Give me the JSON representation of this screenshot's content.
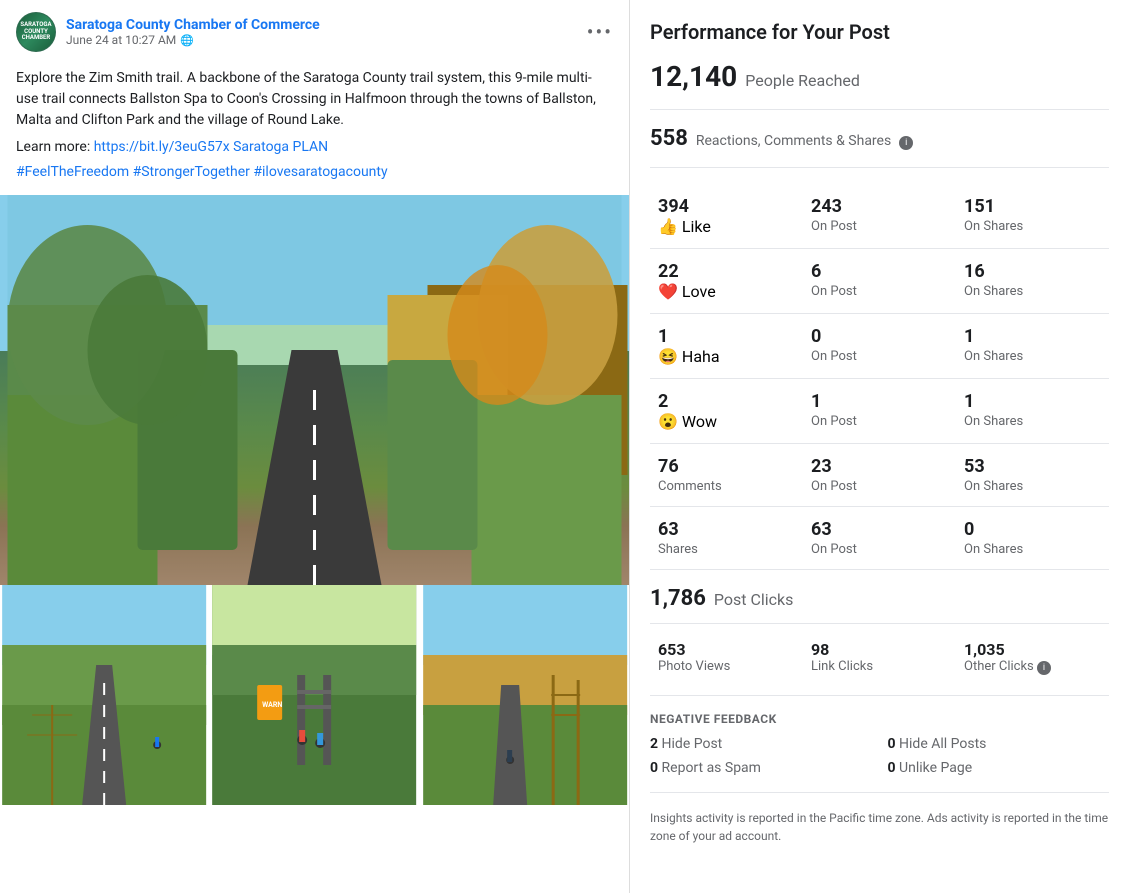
{
  "post": {
    "author": "Saratoga County Chamber of Commerce",
    "date": "June 24 at 10:27 AM",
    "more_icon": "•••",
    "text_parts": [
      "Explore the Zim Smith trail. A backbone of the Saratoga County trail system, this 9-mile multi-use trail connects Ballston Spa to Coon's Crossing in Halfmoon through the towns of Ballston, Malta and Clifton Park and the village of Round Lake.",
      "Learn more: https://bit.ly/3euG57x Saratoga PLAN",
      "#FeelTheFreedom #StrongerTogether #ilovesaratogacounty"
    ],
    "link_text": "https://bit.ly/3euG57x Saratoga PLAN"
  },
  "performance": {
    "title": "Performance for Your Post",
    "people_reached": {
      "number": "12,140",
      "label": "People Reached"
    },
    "reactions_summary": {
      "number": "558",
      "label": "Reactions, Comments & Shares"
    },
    "stats_rows": [
      {
        "type_num": "394",
        "type_emoji": "👍",
        "type_name": "Like",
        "on_post_num": "243",
        "on_post_label": "On Post",
        "on_shares_num": "151",
        "on_shares_label": "On Shares"
      },
      {
        "type_num": "22",
        "type_emoji": "❤️",
        "type_name": "Love",
        "on_post_num": "6",
        "on_post_label": "On Post",
        "on_shares_num": "16",
        "on_shares_label": "On Shares"
      },
      {
        "type_num": "1",
        "type_emoji": "😆",
        "type_name": "Haha",
        "on_post_num": "0",
        "on_post_label": "On Post",
        "on_shares_num": "1",
        "on_shares_label": "On Shares"
      },
      {
        "type_num": "2",
        "type_emoji": "😮",
        "type_name": "Wow",
        "on_post_num": "1",
        "on_post_label": "On Post",
        "on_shares_num": "1",
        "on_shares_label": "On Shares"
      },
      {
        "type_num": "76",
        "type_emoji": "",
        "type_name": "Comments",
        "on_post_num": "23",
        "on_post_label": "On Post",
        "on_shares_num": "53",
        "on_shares_label": "On Shares"
      },
      {
        "type_num": "63",
        "type_emoji": "",
        "type_name": "Shares",
        "on_post_num": "63",
        "on_post_label": "On Post",
        "on_shares_num": "0",
        "on_shares_label": "On Shares"
      }
    ],
    "post_clicks": {
      "number": "1,786",
      "label": "Post Clicks"
    },
    "clicks_breakdown": [
      {
        "num": "653",
        "label": "Photo Views"
      },
      {
        "num": "98",
        "label": "Link Clicks"
      },
      {
        "num": "1,035",
        "label": "Other Clicks"
      }
    ],
    "negative_feedback": {
      "title": "NEGATIVE FEEDBACK",
      "items": [
        {
          "num": "2",
          "label": "Hide Post"
        },
        {
          "num": "0",
          "label": "Hide All Posts"
        },
        {
          "num": "0",
          "label": "Report as Spam"
        },
        {
          "num": "0",
          "label": "Unlike Page"
        }
      ]
    },
    "footnote": "Insights activity is reported in the Pacific time zone. Ads activity is reported in the time zone of your ad account."
  }
}
